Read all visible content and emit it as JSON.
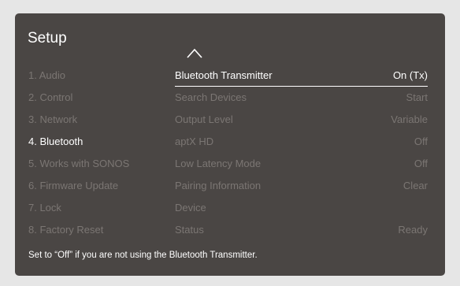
{
  "header": {
    "title": "Setup"
  },
  "icons": {
    "scroll_up": "chevron-up-icon"
  },
  "menu": {
    "items": [
      {
        "label": "1. Audio"
      },
      {
        "label": "2. Control"
      },
      {
        "label": "3. Network"
      },
      {
        "label": "4. Bluetooth"
      },
      {
        "label": "5. Works with SONOS"
      },
      {
        "label": "6. Firmware Update"
      },
      {
        "label": "7. Lock"
      },
      {
        "label": "8. Factory Reset"
      }
    ],
    "selected_index": 3
  },
  "settings": {
    "rows": [
      {
        "label": "Bluetooth Transmitter",
        "value": "On (Tx)"
      },
      {
        "label": "Search Devices",
        "value": "Start"
      },
      {
        "label": "Output Level",
        "value": "Variable"
      },
      {
        "label": "aptX HD",
        "value": "Off"
      },
      {
        "label": "Low Latency Mode",
        "value": "Off"
      },
      {
        "label": "Pairing Information",
        "value": "Clear"
      },
      {
        "label": "Device",
        "value": ""
      },
      {
        "label": "Status",
        "value": "Ready"
      }
    ],
    "active_index": 0
  },
  "footer": {
    "hint": "Set to “Off” if you are not using the Bluetooth Transmitter."
  },
  "colors": {
    "background": "#e6e6e6",
    "panel": "#4a4644",
    "active_text": "#ffffff",
    "inactive_text": "#7b7673"
  }
}
